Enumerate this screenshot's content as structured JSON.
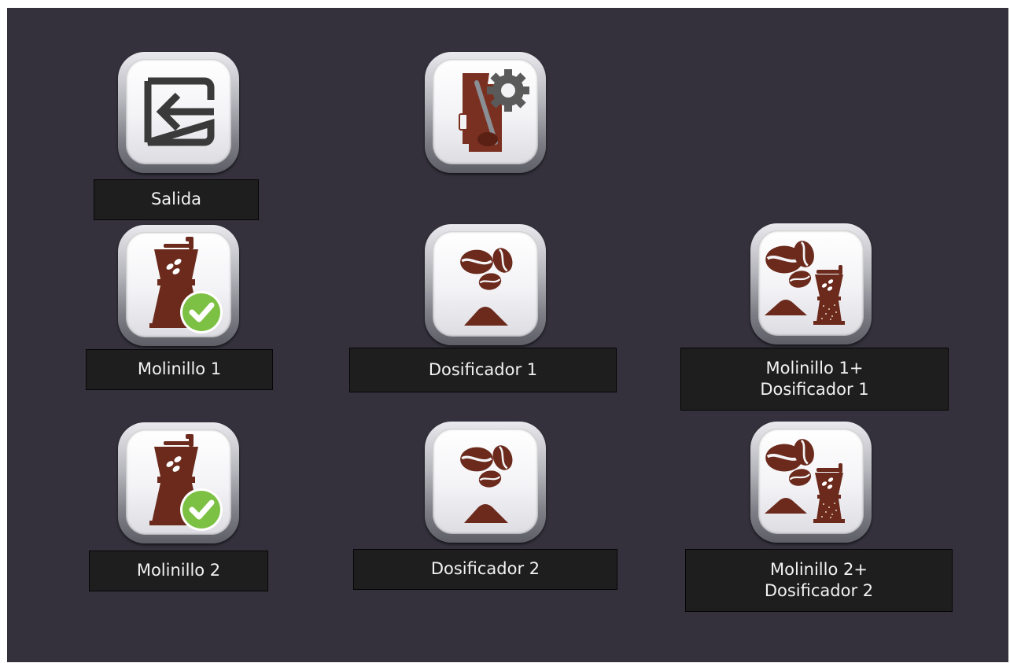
{
  "menu": {
    "exit": {
      "label": "Salida",
      "icon": "exit-icon"
    },
    "settings": {
      "icon": "grinder-settings-icon"
    },
    "grinder_1": {
      "label": "Molinillo 1",
      "icon": "grinder-check-icon"
    },
    "doser_1": {
      "label": "Dosificador 1",
      "icon": "coffee-beans-doser-icon"
    },
    "grinder_doser_1": {
      "label_line1": "Molinillo 1+",
      "label_line2": "Dosificador 1",
      "icon": "beans-grinder-doser-icon"
    },
    "grinder_2": {
      "label": "Molinillo 2",
      "icon": "grinder-check-icon"
    },
    "doser_2": {
      "label": "Dosificador 2",
      "icon": "coffee-beans-doser-icon"
    },
    "grinder_doser_2": {
      "label_line1": "Molinillo 2+",
      "label_line2": "Dosificador 2",
      "icon": "beans-grinder-doser-icon"
    }
  },
  "colors": {
    "background": "#34313c",
    "label_bg": "#1e1e1f",
    "coffee_brown": "#6b2a1c",
    "check_green": "#7cc143"
  }
}
